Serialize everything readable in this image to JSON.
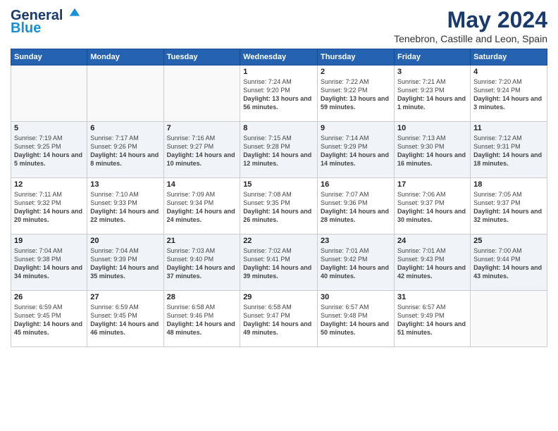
{
  "header": {
    "logo_line1": "General",
    "logo_line2": "Blue",
    "month": "May 2024",
    "location": "Tenebron, Castille and Leon, Spain"
  },
  "weekdays": [
    "Sunday",
    "Monday",
    "Tuesday",
    "Wednesday",
    "Thursday",
    "Friday",
    "Saturday"
  ],
  "weeks": [
    [
      {
        "day": "",
        "info": ""
      },
      {
        "day": "",
        "info": ""
      },
      {
        "day": "",
        "info": ""
      },
      {
        "day": "1",
        "info": "Sunrise: 7:24 AM\nSunset: 9:20 PM\nDaylight: 13 hours and 56 minutes."
      },
      {
        "day": "2",
        "info": "Sunrise: 7:22 AM\nSunset: 9:22 PM\nDaylight: 13 hours and 59 minutes."
      },
      {
        "day": "3",
        "info": "Sunrise: 7:21 AM\nSunset: 9:23 PM\nDaylight: 14 hours and 1 minute."
      },
      {
        "day": "4",
        "info": "Sunrise: 7:20 AM\nSunset: 9:24 PM\nDaylight: 14 hours and 3 minutes."
      }
    ],
    [
      {
        "day": "5",
        "info": "Sunrise: 7:19 AM\nSunset: 9:25 PM\nDaylight: 14 hours and 5 minutes."
      },
      {
        "day": "6",
        "info": "Sunrise: 7:17 AM\nSunset: 9:26 PM\nDaylight: 14 hours and 8 minutes."
      },
      {
        "day": "7",
        "info": "Sunrise: 7:16 AM\nSunset: 9:27 PM\nDaylight: 14 hours and 10 minutes."
      },
      {
        "day": "8",
        "info": "Sunrise: 7:15 AM\nSunset: 9:28 PM\nDaylight: 14 hours and 12 minutes."
      },
      {
        "day": "9",
        "info": "Sunrise: 7:14 AM\nSunset: 9:29 PM\nDaylight: 14 hours and 14 minutes."
      },
      {
        "day": "10",
        "info": "Sunrise: 7:13 AM\nSunset: 9:30 PM\nDaylight: 14 hours and 16 minutes."
      },
      {
        "day": "11",
        "info": "Sunrise: 7:12 AM\nSunset: 9:31 PM\nDaylight: 14 hours and 18 minutes."
      }
    ],
    [
      {
        "day": "12",
        "info": "Sunrise: 7:11 AM\nSunset: 9:32 PM\nDaylight: 14 hours and 20 minutes."
      },
      {
        "day": "13",
        "info": "Sunrise: 7:10 AM\nSunset: 9:33 PM\nDaylight: 14 hours and 22 minutes."
      },
      {
        "day": "14",
        "info": "Sunrise: 7:09 AM\nSunset: 9:34 PM\nDaylight: 14 hours and 24 minutes."
      },
      {
        "day": "15",
        "info": "Sunrise: 7:08 AM\nSunset: 9:35 PM\nDaylight: 14 hours and 26 minutes."
      },
      {
        "day": "16",
        "info": "Sunrise: 7:07 AM\nSunset: 9:36 PM\nDaylight: 14 hours and 28 minutes."
      },
      {
        "day": "17",
        "info": "Sunrise: 7:06 AM\nSunset: 9:37 PM\nDaylight: 14 hours and 30 minutes."
      },
      {
        "day": "18",
        "info": "Sunrise: 7:05 AM\nSunset: 9:37 PM\nDaylight: 14 hours and 32 minutes."
      }
    ],
    [
      {
        "day": "19",
        "info": "Sunrise: 7:04 AM\nSunset: 9:38 PM\nDaylight: 14 hours and 34 minutes."
      },
      {
        "day": "20",
        "info": "Sunrise: 7:04 AM\nSunset: 9:39 PM\nDaylight: 14 hours and 35 minutes."
      },
      {
        "day": "21",
        "info": "Sunrise: 7:03 AM\nSunset: 9:40 PM\nDaylight: 14 hours and 37 minutes."
      },
      {
        "day": "22",
        "info": "Sunrise: 7:02 AM\nSunset: 9:41 PM\nDaylight: 14 hours and 39 minutes."
      },
      {
        "day": "23",
        "info": "Sunrise: 7:01 AM\nSunset: 9:42 PM\nDaylight: 14 hours and 40 minutes."
      },
      {
        "day": "24",
        "info": "Sunrise: 7:01 AM\nSunset: 9:43 PM\nDaylight: 14 hours and 42 minutes."
      },
      {
        "day": "25",
        "info": "Sunrise: 7:00 AM\nSunset: 9:44 PM\nDaylight: 14 hours and 43 minutes."
      }
    ],
    [
      {
        "day": "26",
        "info": "Sunrise: 6:59 AM\nSunset: 9:45 PM\nDaylight: 14 hours and 45 minutes."
      },
      {
        "day": "27",
        "info": "Sunrise: 6:59 AM\nSunset: 9:45 PM\nDaylight: 14 hours and 46 minutes."
      },
      {
        "day": "28",
        "info": "Sunrise: 6:58 AM\nSunset: 9:46 PM\nDaylight: 14 hours and 48 minutes."
      },
      {
        "day": "29",
        "info": "Sunrise: 6:58 AM\nSunset: 9:47 PM\nDaylight: 14 hours and 49 minutes."
      },
      {
        "day": "30",
        "info": "Sunrise: 6:57 AM\nSunset: 9:48 PM\nDaylight: 14 hours and 50 minutes."
      },
      {
        "day": "31",
        "info": "Sunrise: 6:57 AM\nSunset: 9:49 PM\nDaylight: 14 hours and 51 minutes."
      },
      {
        "day": "",
        "info": ""
      }
    ]
  ]
}
